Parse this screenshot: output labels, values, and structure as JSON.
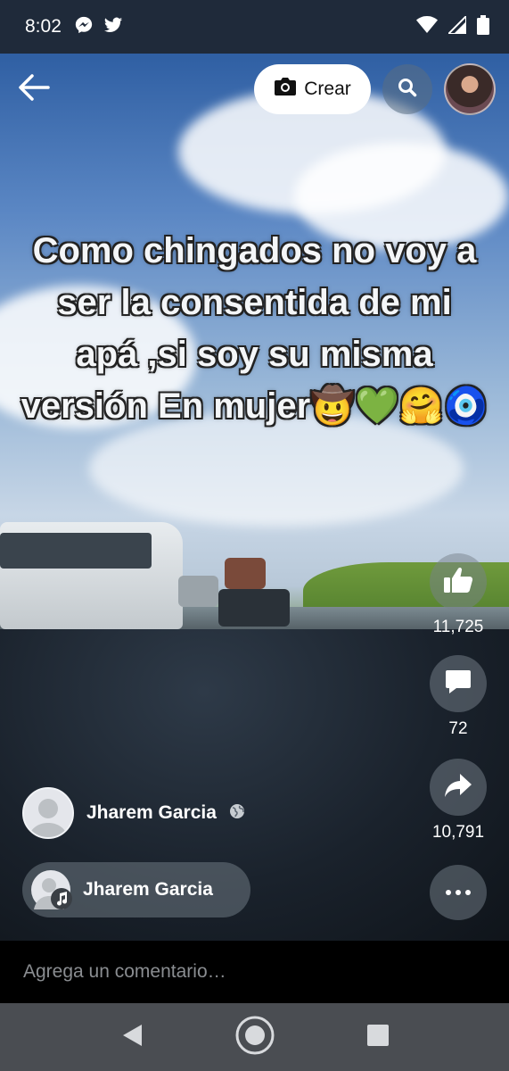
{
  "status_bar": {
    "time": "8:02",
    "left_icons": [
      "messenger-icon",
      "twitter-icon"
    ],
    "right_icons": [
      "wifi-icon",
      "signal-icon",
      "battery-icon"
    ]
  },
  "header": {
    "back_icon": "arrow-left-icon",
    "create_label": "Crear",
    "create_icon": "camera-icon",
    "search_icon": "search-icon"
  },
  "video": {
    "caption_lines": [
      "Como chingados no voy a",
      "ser la consentida de mi",
      "apá ,si soy su misma",
      "versión En mujer🤠💚🤗🧿"
    ]
  },
  "actions": {
    "likes": "11,725",
    "comments": "72",
    "shares": "10,791"
  },
  "author": {
    "name": "Jharem Garcia",
    "privacy_icon": "globe-icon"
  },
  "audio": {
    "name": "Jharem Garcia",
    "icon": "music-note-icon"
  },
  "comment_input": {
    "placeholder": "Agrega un comentario…"
  },
  "nav": {
    "items": [
      "back-triangle-icon",
      "home-circle-icon",
      "recents-square-icon"
    ]
  },
  "colors": {
    "status_bar_bg": "#1f2a3a",
    "nav_bar_bg": "#4a4d52",
    "comment_placeholder": "#8a8d91"
  }
}
